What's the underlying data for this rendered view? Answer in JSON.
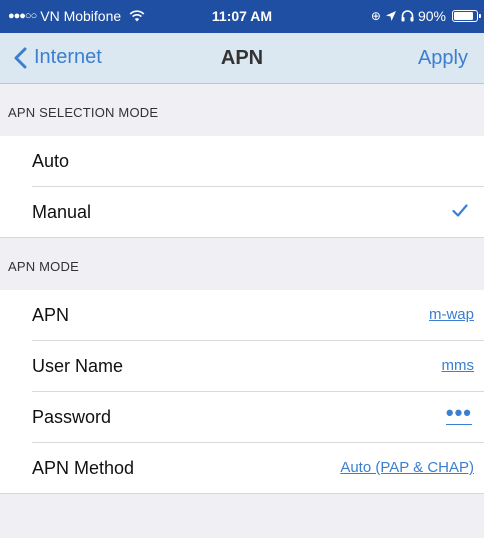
{
  "status_bar": {
    "signal_dots": "●●●○○",
    "carrier": "VN Mobifone",
    "time": "11:07 AM",
    "battery_percent": "90%",
    "battery_level": 0.9,
    "icons": [
      "wifi-icon",
      "location-icon",
      "alarm-icon",
      "headphones-icon",
      "battery-icon"
    ]
  },
  "nav": {
    "back_label": "Internet",
    "title": "APN",
    "apply_label": "Apply"
  },
  "sections": {
    "selection_mode_header": "APN SELECTION MODE",
    "apn_mode_header": "APN MODE"
  },
  "selection_mode": {
    "auto_label": "Auto",
    "manual_label": "Manual",
    "selected": "Manual"
  },
  "apn_mode": {
    "apn_label": "APN",
    "apn_value": "m-wap",
    "username_label": "User Name",
    "username_value": "mms",
    "password_label": "Password",
    "password_value": "•••",
    "method_label": "APN Method",
    "method_value": "Auto (PAP & CHAP)"
  },
  "colors": {
    "status_bar_bg": "#1f4fa3",
    "nav_bg": "#dbe7f1",
    "accent": "#3a7fd0",
    "group_bg": "#efeff4"
  }
}
